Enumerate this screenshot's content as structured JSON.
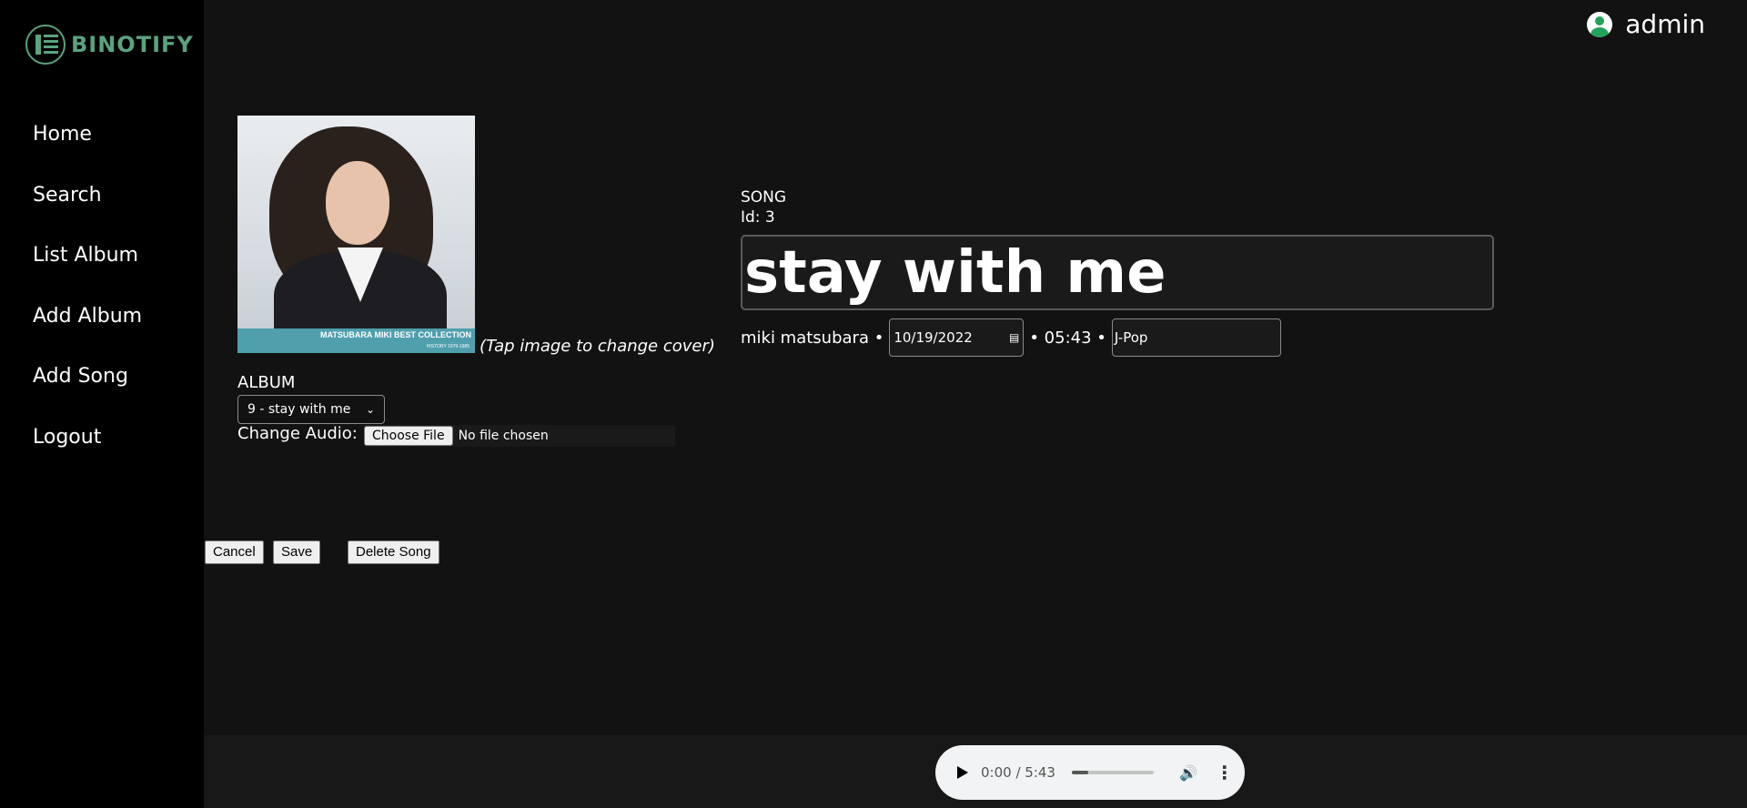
{
  "app": {
    "name": "BINOTIFY"
  },
  "sidebar": {
    "items": [
      {
        "label": "Home"
      },
      {
        "label": "Search"
      },
      {
        "label": "List Album"
      },
      {
        "label": "Add Album"
      },
      {
        "label": "Add Song"
      },
      {
        "label": "Logout"
      }
    ]
  },
  "header": {
    "user": "admin"
  },
  "cover": {
    "text": "MATSUBARA MIKI BEST COLLECTION",
    "subtext": "HISTORY 1979-1985",
    "hint": "(Tap image to change cover)"
  },
  "album": {
    "label": "ALBUM",
    "selected": "9 - stay with me"
  },
  "audio": {
    "label": "Change Audio:",
    "button": "Choose File",
    "status": "No file chosen"
  },
  "song": {
    "type_label": "SONG",
    "id_label": "Id: 3",
    "title": "stay with me",
    "artist": "miki matsubara",
    "date": "10/19/2022",
    "duration": "05:43",
    "genre": "J-Pop"
  },
  "actions": {
    "cancel": "Cancel",
    "save": "Save",
    "delete": "Delete Song"
  },
  "player": {
    "time": "0:00 / 5:43",
    "progress": 0.2
  },
  "colors": {
    "brand": "#5aa37f",
    "user_icon": "#22a35a"
  }
}
